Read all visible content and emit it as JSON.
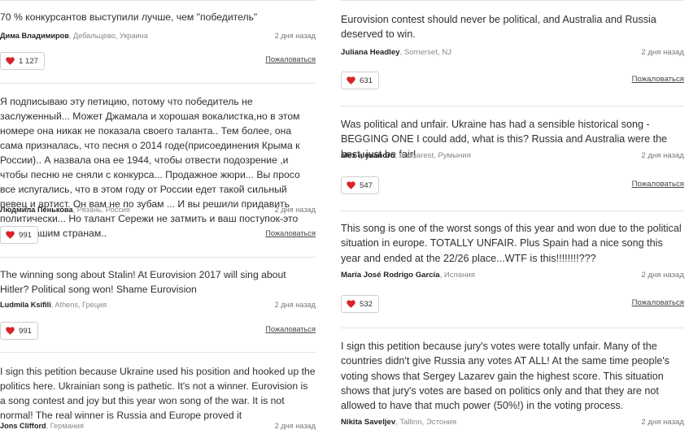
{
  "colors": {
    "heart": "#d8232a",
    "separator": "#e3e3e3",
    "author": "#222222",
    "location": "#888888"
  },
  "left_column": [
    {
      "text": "70 % конкурсантов выступили лучше, чем \"победитель\"",
      "author": "Дима Владимиров",
      "location": ", Дебальцево, Украина",
      "date": "2 дня назад",
      "likes": "1 127",
      "report": "Пожаловаться"
    },
    {
      "text": "Я подписываю эту петицию, потому что победитель не заслуженный... Может Джамала и хорошая вокалистка,но в этом номере она никак не показала своего таланта.. Тем более, она сама призналась, что песня о 2014 годе(присоединения Крыма к России).. А назвала она ее 1944, чтобы отвести подозрение ,и чтобы песню не сняли с конкурса... Продажное жюри... Вы просо все испугались, что в этом году от России едет такой сильный певец и артист. Он вам не по зубам ... И вы решили придавить политически... Но талант Сережи не затмить и ваш поступок-это позор вашим странам..",
      "author": "Людмила Пенькова",
      "location": ", Рязань, Россия",
      "date": "2 дня назад",
      "likes": "991",
      "report": "Пожаловаться"
    },
    {
      "text": "The winning song about Stalin! At Eurovision 2017 will sing about Hitler? Political song won! Shame Eurovision",
      "author": "Ludmila Ksifili",
      "location": ", Athens, Греция",
      "date": "2 дня назад",
      "likes": "991",
      "report": "Пожаловаться"
    },
    {
      "text": "I sign this petition because Ukraine used his position and hooked up the politics here. Ukrainian song is pathetic. It's not a winner. Eurovision is a song contest and joy but this year won song of the war. It is not normal! The real winner is Russia and Europe proved it",
      "author": "Jons Clifford",
      "location": ", Германия",
      "date": "2 дня назад"
    }
  ],
  "right_column": [
    {
      "text": "Eurovision contest should never be political, and Australia and Russia deserved to win.",
      "author": "Juliana Headley",
      "location": ", Somerset, NJ",
      "date": "2 дня назад",
      "likes": "631",
      "report": "Пожаловаться"
    },
    {
      "text": "Was political and unfair. Ukraine has had a sensible historical song - BEGGING ONE I could add, what is this? Russia and Australia were the best, just be fair!",
      "author": "alex alexandro",
      "location": ", bucharest, Румыния",
      "date": "2 дня назад",
      "likes": "547",
      "report": "Пожаловаться"
    },
    {
      "text": "This song is one of the worst songs of this year and won due to the political situation in europe. TOTALLY UNFAIR. Plus Spain had a nice song this year and ended at the 22/26 place...WTF is this!!!!!!!!???",
      "author": "María José Rodrigo García",
      "location": ", Испания",
      "date": "2 дня назад",
      "likes": "532",
      "report": "Пожаловаться"
    },
    {
      "text": "I sign this petition because jury's votes were totally unfair. Many of the countries didn't give Russia any votes AT ALL! At the same time people's voting shows that Sergey Lazarev gain the highest score. This situation shows that jury's votes are based on politics only and that they are not allowed to have that much power (50%!) in the voting process.",
      "author": "Nikita Saveljev",
      "location": ", Tallinn, Эстония",
      "date": "2 дня назад"
    }
  ]
}
